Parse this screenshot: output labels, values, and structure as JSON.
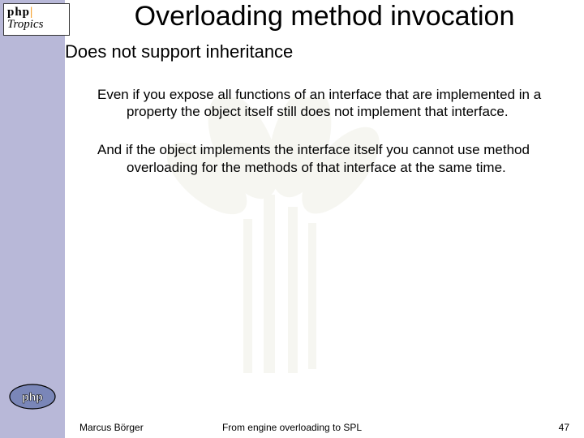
{
  "logo": {
    "line1_php": "php",
    "line1_pipe": "|",
    "line2": "Tropics"
  },
  "title": "Overloading method invocation",
  "bullet": {
    "mark": "☒",
    "text": "Does not support inheritance"
  },
  "paragraphs": {
    "p1": "Even if you expose all functions of an interface that are implemented in a property the object itself still does not implement that interface.",
    "p2": "And if the object implements the interface itself you cannot use method overloading for the methods of that interface at the same time."
  },
  "footer": {
    "author": "Marcus Börger",
    "center": "From engine overloading to SPL",
    "page": "47"
  }
}
